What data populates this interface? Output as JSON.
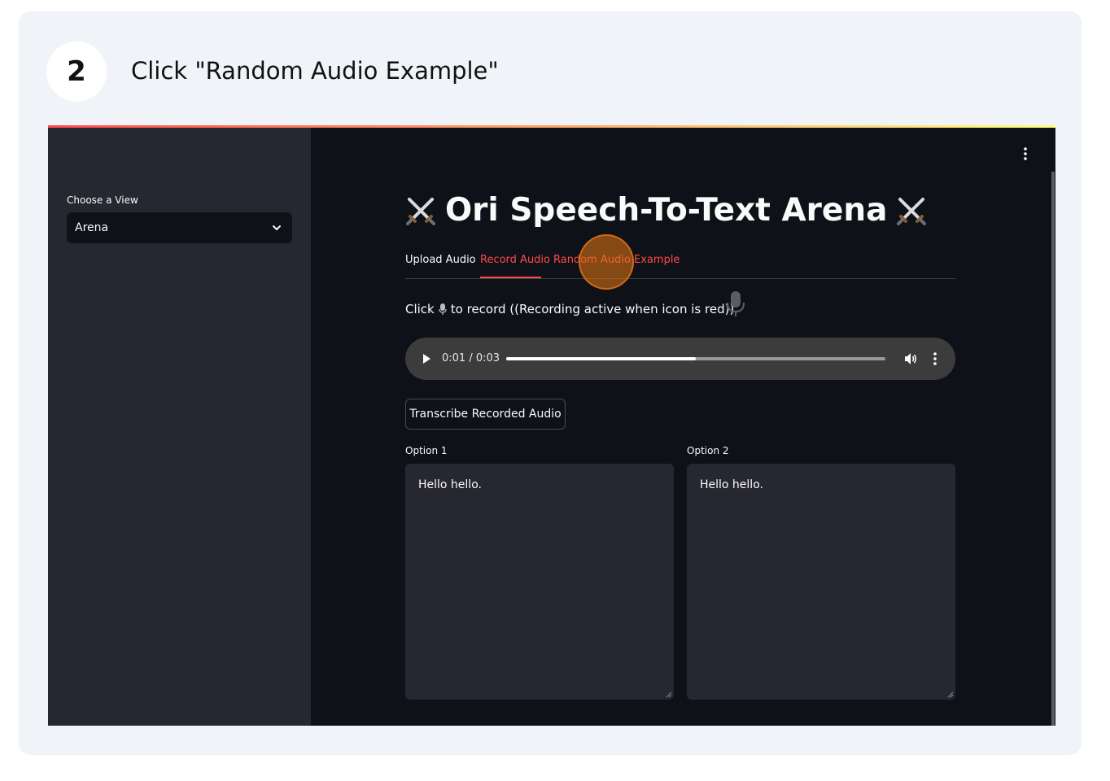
{
  "step": {
    "number": "2",
    "title": "Click \"Random Audio Example\""
  },
  "sidebar": {
    "label": "Choose a View",
    "selected": "Arena"
  },
  "main": {
    "title": "Ori Speech-To-Text Arena",
    "tabs": [
      {
        "label": "Upload Audio"
      },
      {
        "label": "Record Audio"
      },
      {
        "label": "Random Audio Example"
      }
    ],
    "instruction_prefix": "Click",
    "instruction_suffix": "to record ((Recording active when icon is red))",
    "player": {
      "time": "0:01 / 0:03",
      "progress": 0.5
    },
    "transcribe_button": "Transcribe Recorded Audio",
    "options": [
      {
        "label": "Option 1",
        "text": "Hello hello."
      },
      {
        "label": "Option 2",
        "text": "Hello hello."
      }
    ]
  },
  "colors": {
    "accent": "#ff4b4b",
    "background": "#0e1117",
    "sidebar": "#262730",
    "click_marker": "#e67814"
  },
  "icons": [
    "crossed-swords-icon",
    "chevron-down-icon",
    "more-vertical-icon",
    "microphone-icon",
    "play-icon",
    "volume-icon"
  ]
}
